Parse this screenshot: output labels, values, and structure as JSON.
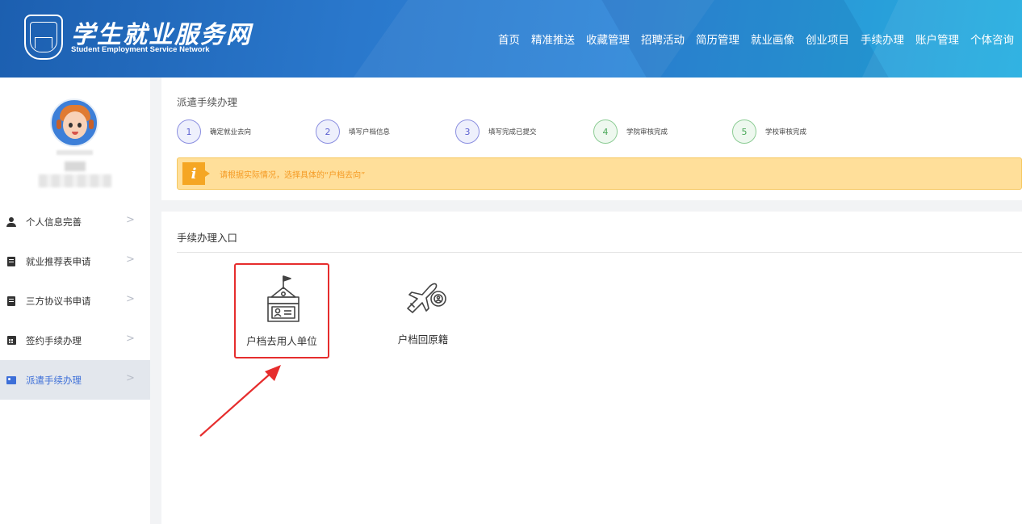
{
  "header": {
    "title": "学生就业服务网",
    "subtitle": "Student Employment Service Network",
    "nav": [
      "首页",
      "精准推送",
      "收藏管理",
      "招聘活动",
      "简历管理",
      "就业画像",
      "创业项目",
      "手续办理",
      "账户管理",
      "个体咨询"
    ]
  },
  "sidebar": {
    "menu": [
      {
        "label": "个人信息完善",
        "icon": "user-icon"
      },
      {
        "label": "就业推荐表申请",
        "icon": "document-icon"
      },
      {
        "label": "三方协议书申请",
        "icon": "document-icon"
      },
      {
        "label": "签约手续办理",
        "icon": "calendar-icon"
      },
      {
        "label": "派遣手续办理",
        "icon": "id-card-icon",
        "active": true
      }
    ]
  },
  "process": {
    "title": "派遣手续办理",
    "steps": [
      {
        "num": "1",
        "label": "确定就业去向"
      },
      {
        "num": "2",
        "label": "填写户档信息"
      },
      {
        "num": "3",
        "label": "填写完成已提交"
      },
      {
        "num": "4",
        "label": "学院审核完成"
      },
      {
        "num": "5",
        "label": "学校审核完成"
      }
    ],
    "notice": "请根据实际情况，选择具体的“户档去向”"
  },
  "entries": {
    "title": "手续办理入口",
    "items": [
      {
        "label": "户档去用人单位",
        "icon": "employer-building-icon"
      },
      {
        "label": "户档回原籍",
        "icon": "airplane-icon"
      }
    ]
  },
  "colors": {
    "header_start": "#1c5fb0",
    "header_end": "#22aee0",
    "step_purple": "#5a5fd0",
    "step_green": "#4aa858",
    "notice_bg": "#ffdf9a",
    "notice_text": "#f59a23",
    "highlight_red": "#e62d2d",
    "active_menu": "#3d6fd8"
  }
}
